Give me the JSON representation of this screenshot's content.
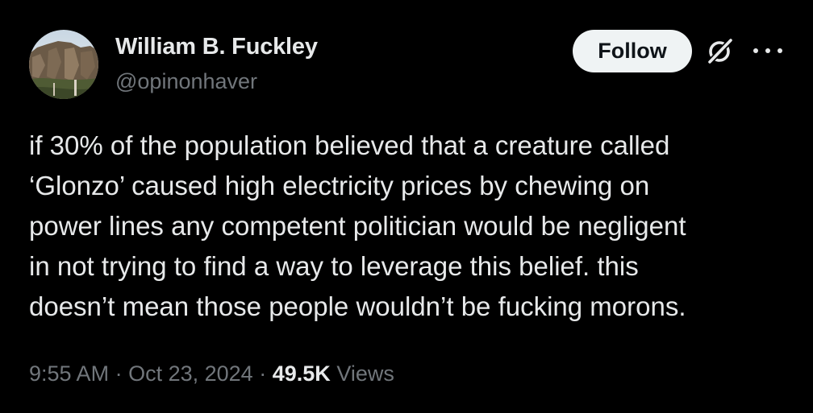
{
  "author": {
    "display_name": "William B. Fuckley",
    "handle": "@opinonhaver"
  },
  "actions": {
    "follow_label": "Follow",
    "grok_icon": "grok-icon",
    "more_icon": "more-icon"
  },
  "tweet": {
    "lines": [
      "if 30% of the population believed that a creature called",
      "‘Glonzo’ caused high electricity prices by chewing on",
      "power lines any competent politician would be negligent",
      "in not trying to find a way to leverage this belief. this",
      "doesn’t mean those people wouldn’t be fucking morons."
    ]
  },
  "meta": {
    "time": "9:55 AM",
    "separator": "·",
    "date": "Oct 23, 2024",
    "views_count": "49.5K",
    "views_label": "Views"
  },
  "colors": {
    "background": "#000000",
    "primary_text": "#e7e9ea",
    "secondary_text": "#71767b",
    "follow_button_bg": "#eff3f4",
    "follow_button_text": "#0f1419"
  }
}
